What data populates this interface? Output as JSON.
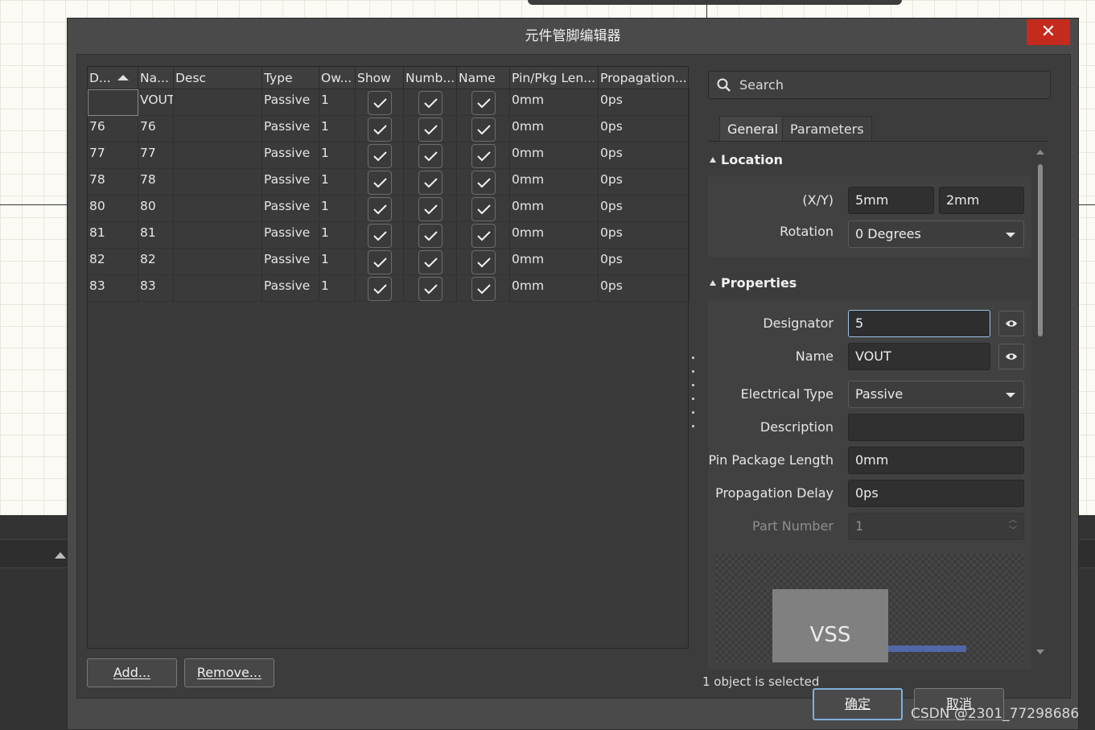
{
  "dialog": {
    "title": "元件管脚编辑器",
    "close_label": "✕"
  },
  "grid": {
    "columns": [
      "D...",
      "Na...",
      "Desc",
      "Type",
      "Ow...",
      "Show",
      "Numb...",
      "Name",
      "Pin/Pkg Len...",
      "Propagation..."
    ],
    "rows": [
      {
        "designator": "",
        "name": "VOUT",
        "desc": "",
        "type": "Passive",
        "owner": "1",
        "show": true,
        "number": true,
        "name_vis": true,
        "pin_len": "0mm",
        "prop": "0ps"
      },
      {
        "designator": "76",
        "name": "76",
        "desc": "",
        "type": "Passive",
        "owner": "1",
        "show": true,
        "number": true,
        "name_vis": true,
        "pin_len": "0mm",
        "prop": "0ps"
      },
      {
        "designator": "77",
        "name": "77",
        "desc": "",
        "type": "Passive",
        "owner": "1",
        "show": true,
        "number": true,
        "name_vis": true,
        "pin_len": "0mm",
        "prop": "0ps"
      },
      {
        "designator": "78",
        "name": "78",
        "desc": "",
        "type": "Passive",
        "owner": "1",
        "show": true,
        "number": true,
        "name_vis": true,
        "pin_len": "0mm",
        "prop": "0ps"
      },
      {
        "designator": "80",
        "name": "80",
        "desc": "",
        "type": "Passive",
        "owner": "1",
        "show": true,
        "number": true,
        "name_vis": true,
        "pin_len": "0mm",
        "prop": "0ps"
      },
      {
        "designator": "81",
        "name": "81",
        "desc": "",
        "type": "Passive",
        "owner": "1",
        "show": true,
        "number": true,
        "name_vis": true,
        "pin_len": "0mm",
        "prop": "0ps"
      },
      {
        "designator": "82",
        "name": "82",
        "desc": "",
        "type": "Passive",
        "owner": "1",
        "show": true,
        "number": true,
        "name_vis": true,
        "pin_len": "0mm",
        "prop": "0ps"
      },
      {
        "designator": "83",
        "name": "83",
        "desc": "",
        "type": "Passive",
        "owner": "1",
        "show": true,
        "number": true,
        "name_vis": true,
        "pin_len": "0mm",
        "prop": "0ps"
      }
    ]
  },
  "buttons": {
    "add": "Add...",
    "remove": "Remove...",
    "ok": "确定",
    "cancel": "取消"
  },
  "panel": {
    "search_placeholder": "Search",
    "tabs": [
      "General",
      "Parameters"
    ],
    "location": {
      "heading": "Location",
      "xy_label": "(X/Y)",
      "x": "5mm",
      "y": "2mm",
      "rotation_label": "Rotation",
      "rotation": "0 Degrees"
    },
    "properties": {
      "heading": "Properties",
      "designator_label": "Designator",
      "designator": "5",
      "name_label": "Name",
      "name": "VOUT",
      "etype_label": "Electrical Type",
      "etype": "Passive",
      "desc_label": "Description",
      "desc": "",
      "pinlen_label": "Pin Package Length",
      "pinlen": "0mm",
      "prop_label": "Propagation Delay",
      "prop": "0ps",
      "part_label": "Part Number",
      "part": "1"
    },
    "preview_text": "VSS",
    "status": "1 object is selected"
  },
  "watermark": "CSDN @2301_77298686",
  "colors": {
    "close": "#c42b1c",
    "focus": "#9dc3e6",
    "pin_line": "#5267a8"
  }
}
